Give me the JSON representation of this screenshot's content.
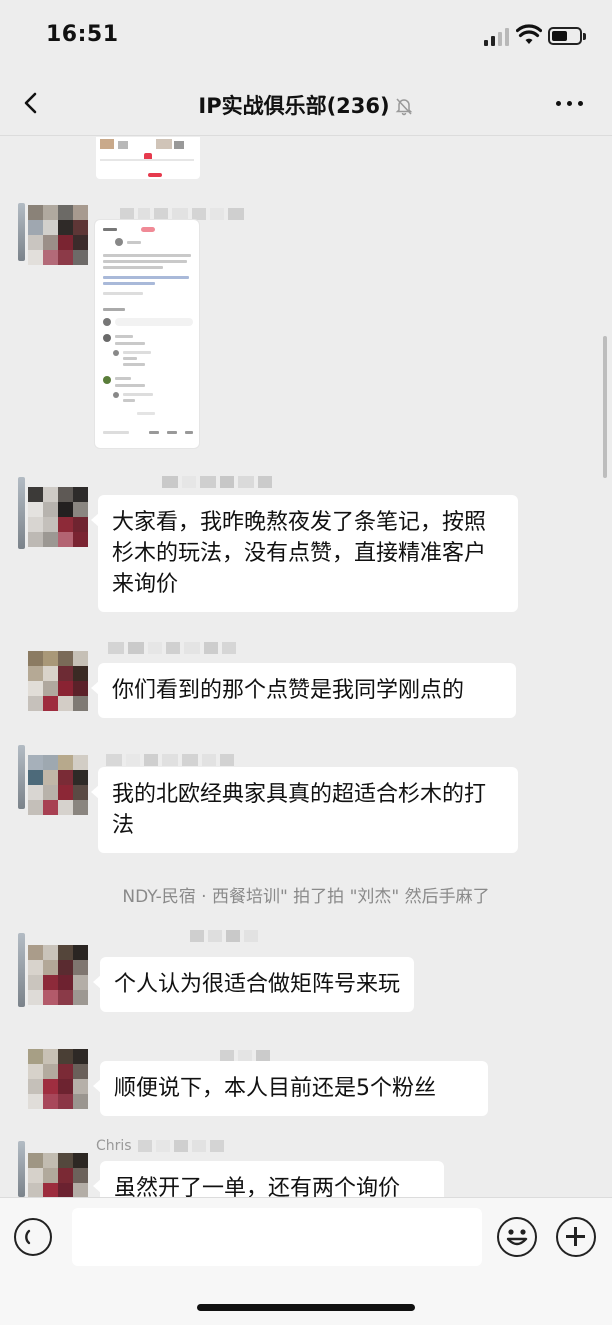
{
  "status_bar": {
    "time": "16:51",
    "icons": [
      "cellular-signal-icon",
      "wifi-icon",
      "battery-icon"
    ]
  },
  "nav": {
    "title": "IP实战俱乐部(236)",
    "back_icon": "chevron-left-icon",
    "mute_icon": "bell-muted-icon",
    "more_icon": "ellipsis-icon"
  },
  "messages": [
    {
      "type": "image",
      "description_icon": "screenshot-thumbnail"
    },
    {
      "type": "text",
      "text": "大家看，我昨晚熬夜发了条笔记，按照杉木的玩法，没有点赞，直接精准客户来询价"
    },
    {
      "type": "text",
      "text": "你们看到的那个点赞是我同学刚点的"
    },
    {
      "type": "text",
      "text": "我的北欧经典家具真的超适合杉木的打法"
    },
    {
      "type": "system",
      "text": "NDY-民宿 · 西餐培训\" 拍了拍 \"刘杰\" 然后手麻了"
    },
    {
      "type": "text",
      "text": "个人认为很适合做矩阵号来玩"
    },
    {
      "type": "text",
      "text": "顺便说下，本人目前还是5个粉丝"
    },
    {
      "type": "text",
      "sender": "Chris",
      "text": "虽然开了一单，还有两个询价"
    }
  ],
  "input_bar": {
    "placeholder": "",
    "voice_icon": "voice-icon",
    "emoji_icon": "emoji-icon",
    "plus_icon": "plus-icon"
  },
  "colors": {
    "background": "#ededed",
    "bubble": "#ffffff",
    "system_text": "#8a8a8a"
  }
}
